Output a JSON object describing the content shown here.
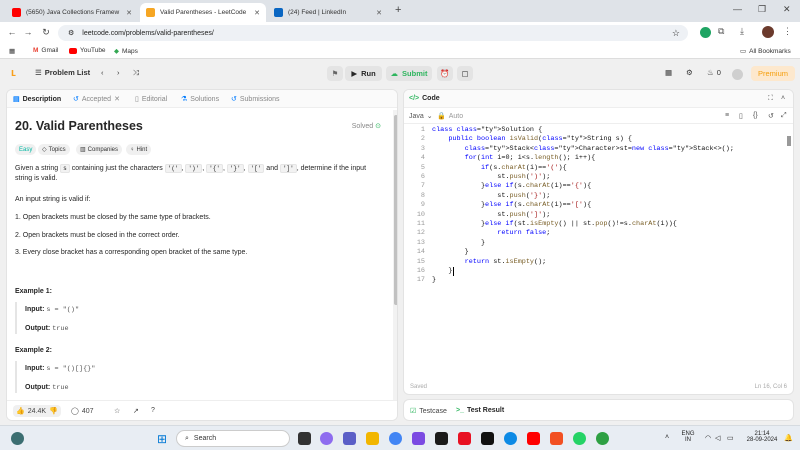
{
  "browser": {
    "tabs": [
      {
        "title": "(5650) Java Collections Framew",
        "color": "#ff0000"
      },
      {
        "title": "Valid Parentheses - LeetCode",
        "color": "#f6a623"
      },
      {
        "title": "(24) Feed | LinkedIn",
        "color": "#0a66c2"
      }
    ],
    "url": "leetcode.com/problems/valid-parentheses/",
    "bookmarks": [
      "Gmail",
      "YouTube",
      "Maps"
    ],
    "all_bookmarks": "All Bookmarks"
  },
  "header": {
    "problem_list": "Problem List",
    "run": "Run",
    "submit": "Submit",
    "streak": "0",
    "premium": "Premium"
  },
  "left": {
    "tabs": [
      "Description",
      "Accepted",
      "Editorial",
      "Solutions",
      "Submissions"
    ],
    "title": "20. Valid Parentheses",
    "solved": "Solved",
    "tags": [
      "Easy",
      "Topics",
      "Companies",
      "Hint"
    ],
    "desc_pre": "Given a string",
    "desc_var": "s",
    "desc_mid": "containing just the characters",
    "chars": [
      "'('",
      "')'",
      "'{'",
      "'}'",
      "'['",
      "']'"
    ],
    "desc_and": "and",
    "desc_post": ", determine if the input string",
    "desc_line2": "is valid.",
    "valid_if": "An input string is valid if:",
    "rules": [
      "1. Open brackets must be closed by the same type of brackets.",
      "2. Open brackets must be closed in the correct order.",
      "3. Every close bracket has a corresponding open bracket of the same type."
    ],
    "examples": [
      {
        "heading": "Example 1:",
        "input_label": "Input:",
        "input": "s = \"()\"",
        "output_label": "Output:",
        "output": "true"
      },
      {
        "heading": "Example 2:",
        "input_label": "Input:",
        "input": "s = \"()[]{}\"",
        "output_label": "Output:",
        "output": "true"
      }
    ],
    "likes": "24.4K",
    "comments": "407"
  },
  "right": {
    "title": "Code",
    "language": "Java",
    "auto": "Auto",
    "saved": "Saved",
    "cursor": "Ln 16, Col 6",
    "bottom_tabs": [
      "Testcase",
      "Test Result"
    ]
  },
  "code_lines": [
    "class Solution {",
    "    public boolean isValid(String s) {",
    "        Stack<Character>st=new Stack<>();",
    "        for(int i=0; i<s.length(); i++){",
    "            if(s.charAt(i)=='('){",
    "                st.push(')');",
    "            }else if(s.charAt(i)=='{'){",
    "                st.push('}');",
    "            }else if(s.charAt(i)=='['){",
    "                st.push(']');",
    "            }else if(st.isEmpty() || st.pop()!=s.charAt(i)){",
    "                return false;",
    "            }",
    "        }",
    "        return st.isEmpty();",
    "    }",
    "}"
  ],
  "taskbar": {
    "search": "Search",
    "lang_top": "ENG",
    "lang_bottom": "IN",
    "time": "21:14",
    "date": "28-09-2024"
  }
}
